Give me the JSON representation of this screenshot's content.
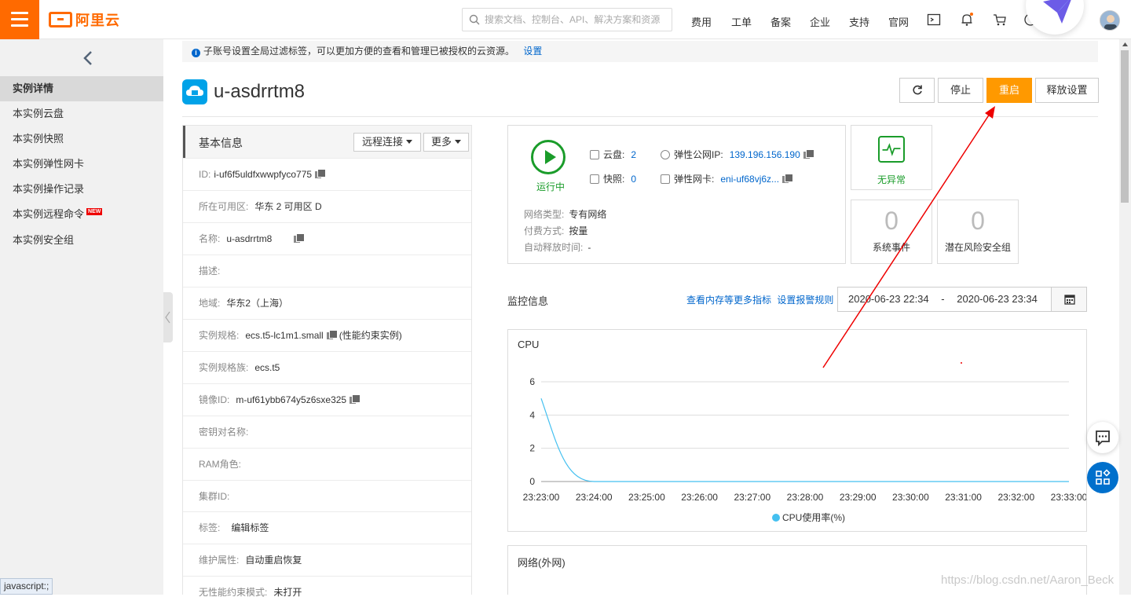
{
  "topbar": {
    "logo_text": "阿里云",
    "search_placeholder": "搜索文档、控制台、API、解决方案和资源",
    "nav": [
      "费用",
      "工单",
      "备案",
      "企业",
      "支持",
      "官网"
    ]
  },
  "sidebar": {
    "items": [
      {
        "label": "实例详情",
        "active": true
      },
      {
        "label": "本实例云盘"
      },
      {
        "label": "本实例快照"
      },
      {
        "label": "本实例弹性网卡"
      },
      {
        "label": "本实例操作记录"
      },
      {
        "label": "本实例远程命令",
        "badge": "NEW"
      },
      {
        "label": "本实例安全组"
      }
    ]
  },
  "notice": {
    "text": "子账号设置全局过滤标签，可以更加方便的查看和管理已被授权的云资源。",
    "link": "设置"
  },
  "instance": {
    "title": "u-asdrrtm8",
    "buttons": {
      "stop": "停止",
      "restart": "重启",
      "release": "释放设置"
    }
  },
  "basic": {
    "title": "基本信息",
    "remote_btn": "远程连接",
    "more_btn": "更多",
    "rows": [
      {
        "label": "ID:",
        "value": "i-uf6f5uldfxwwpfyco775"
      },
      {
        "label": "所在可用区:",
        "value": "华东 2 可用区 D"
      },
      {
        "label": "名称:",
        "value": "u-asdrrtm8"
      },
      {
        "label": "描述:",
        "value": ""
      },
      {
        "label": "地域:",
        "value": "华东2（上海）"
      },
      {
        "label": "实例规格:",
        "value": "ecs.t5-lc1m1.small",
        "extra": "(性能约束实例)"
      },
      {
        "label": "实例规格族:",
        "value": "ecs.t5"
      },
      {
        "label": "镜像ID:",
        "value": "m-uf61ybb674y5z6sxe325"
      },
      {
        "label": "密钥对名称:",
        "value": ""
      },
      {
        "label": "RAM角色:",
        "value": ""
      },
      {
        "label": "集群ID:",
        "value": ""
      },
      {
        "label": "标签:",
        "value": "编辑标签"
      },
      {
        "label": "维护属性:",
        "value": "自动重启恢复"
      },
      {
        "label": "无性能约束模式:",
        "value": "未打开"
      }
    ]
  },
  "status": {
    "state": "运行中",
    "disk_label": "云盘:",
    "disk_value": "2",
    "snapshot_label": "快照:",
    "snapshot_value": "0",
    "eip_label": "弹性公网IP:",
    "eip_value": "139.196.156.190",
    "eni_label": "弹性网卡:",
    "eni_value": "eni-uf68vj6z...",
    "network_type_label": "网络类型:",
    "network_type_value": "专有网络",
    "billing_label": "付费方式:",
    "billing_value": "按量",
    "auto_release_label": "自动释放时间:",
    "auto_release_value": "-"
  },
  "health": {
    "text": "无异常"
  },
  "events": {
    "count": "0",
    "label": "系统事件"
  },
  "risk": {
    "count": "0",
    "label": "潜在风险安全组"
  },
  "monitor": {
    "title": "监控信息",
    "link1": "查看内存等更多指标",
    "link2": "设置报警规则",
    "date_start": "2020-06-23 22:34",
    "date_sep": "-",
    "date_end": "2020-06-23 23:34"
  },
  "cpu_title": "CPU",
  "net_title": "网络(外网)",
  "statusbar": "javascript:;",
  "watermark": "https://blog.csdn.net/Aaron_Beck",
  "chart_data": {
    "type": "line",
    "title": "CPU",
    "categories": [
      "23:23:00",
      "23:24:00",
      "23:25:00",
      "23:26:00",
      "23:27:00",
      "23:28:00",
      "23:29:00",
      "23:30:00",
      "23:31:00",
      "23:32:00",
      "23:33:00"
    ],
    "series": [
      {
        "name": "CPU使用率(%)",
        "color": "#44c0f0",
        "values": [
          5,
          0,
          0,
          0,
          0,
          0,
          0,
          0,
          0,
          0,
          0
        ]
      }
    ],
    "yticks": [
      0,
      2,
      4,
      6
    ],
    "ylim": [
      0,
      6
    ],
    "grid": true,
    "legend": "bottom"
  }
}
